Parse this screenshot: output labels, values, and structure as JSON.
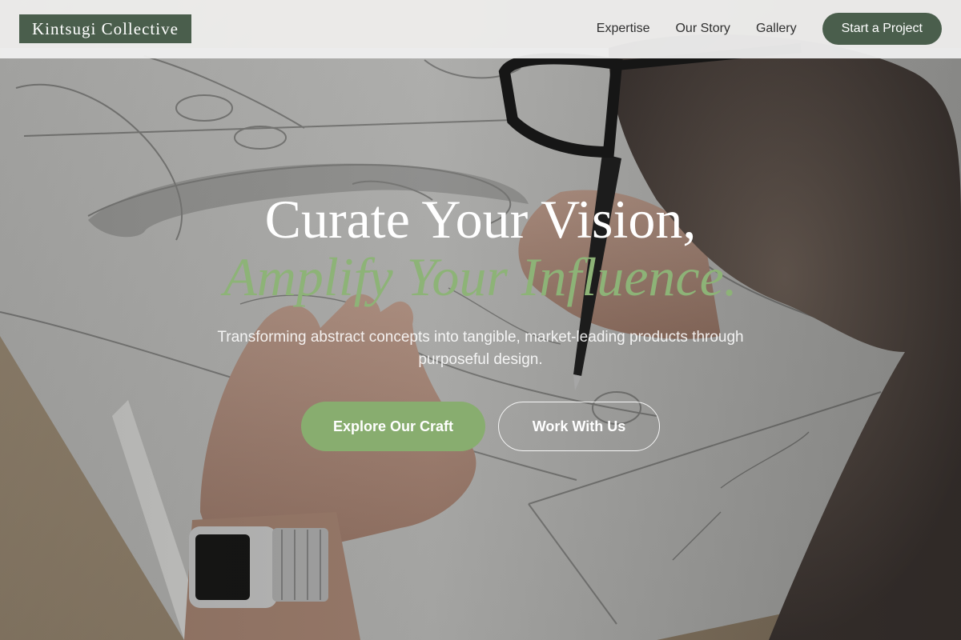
{
  "header": {
    "logo": "Kintsugi Collective",
    "nav": [
      {
        "label": "Expertise"
      },
      {
        "label": "Our Story"
      },
      {
        "label": "Gallery"
      }
    ],
    "cta_label": "Start a Project"
  },
  "hero": {
    "headline_line1": "Curate Your Vision,",
    "headline_line2": "Amplify Your Influence.",
    "subtitle": "Transforming abstract concepts into tangible, market-leading products through purposeful design.",
    "primary_button": "Explore Our Craft",
    "secondary_button": "Work With Us",
    "background_image": "designer-sketching-product-drawings-photo"
  },
  "colors": {
    "brand_green": "#4a5e4c",
    "accent_green": "#88ad6f",
    "headline_accent": "#8db377"
  }
}
